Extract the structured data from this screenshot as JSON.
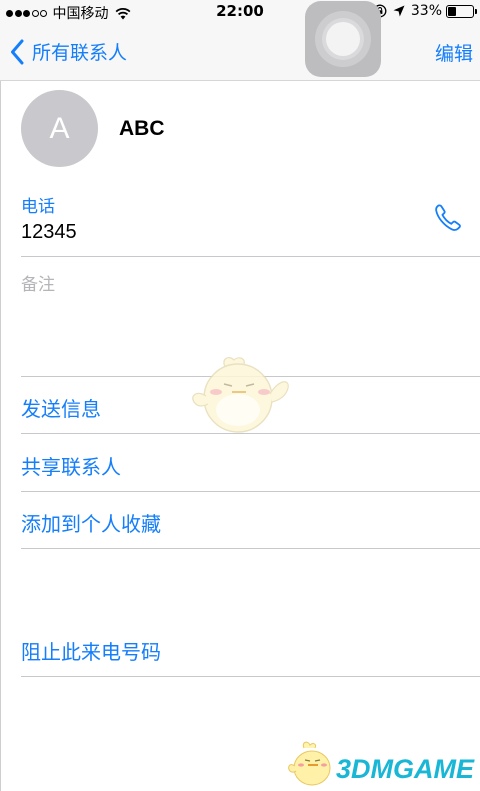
{
  "status_bar": {
    "carrier": "中国移动",
    "time": "22:00",
    "battery_percent": "33%",
    "battery_level": 0.33
  },
  "nav": {
    "back_label": "所有联系人",
    "edit_label": "编辑"
  },
  "contact": {
    "avatar_initial": "A",
    "name": "ABC"
  },
  "phone": {
    "label": "电话",
    "value": "12345"
  },
  "notes": {
    "label": "备注"
  },
  "actions": {
    "send_message": "发送信息",
    "share_contact": "共享联系人",
    "add_favorite": "添加到个人收藏",
    "block_caller": "阻止此来电号码"
  },
  "watermark": {
    "logo_text": "3DMGAME"
  },
  "colors": {
    "accent": "#147efb",
    "avatar_bg": "#c8c8cd",
    "logo": "#19b6d6"
  }
}
